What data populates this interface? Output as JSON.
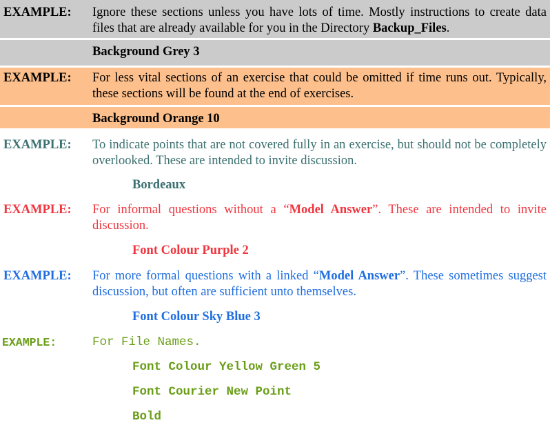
{
  "colors": {
    "grey_bg": "#cbcbcb",
    "orange_bg": "#fdbf8b",
    "bordeaux": "#3b7070",
    "purple": "#f0363f",
    "sky_blue": "#1f6ee0",
    "yellow_green": "#6a9e17"
  },
  "rows": [
    {
      "label": "EXAMPLE:",
      "text_before": "Ignore these sections unless you have lots of time. Mostly instructions to create data files that are already available for you in the Directory ",
      "text_bold": "Backup_Files",
      "text_after": ".",
      "sub": "Background Grey 3"
    },
    {
      "label": "EXAMPLE:",
      "text": "For less vital sections of an exercise that could be omitted if time runs out. Typically, these sections will be found at the end of exercises.",
      "sub": "Background Orange 10"
    },
    {
      "label": "EXAMPLE:",
      "text": "To indicate points that are not covered fully in an exercise, but should not be completely overlooked. These are intended to invite discussion.",
      "sub": "Bordeaux"
    },
    {
      "label": "EXAMPLE:",
      "text_before": "For informal questions without a “",
      "text_bold": "Model Answer",
      "text_after": "”. These are intended to invite discussion.",
      "sub": "Font Colour Purple 2"
    },
    {
      "label": "EXAMPLE:",
      "text_before": "For more formal questions with a linked “",
      "text_bold": "Model Answer",
      "text_after": "”. These sometimes suggest discussion, but often are sufficient unto themselves.",
      "sub": "Font Colour Sky Blue 3"
    },
    {
      "label": "EXAMPLE:",
      "text": "For File Names.",
      "subs": [
        "Font Colour Yellow Green 5",
        "Font Courier New Point",
        "Bold"
      ]
    }
  ]
}
